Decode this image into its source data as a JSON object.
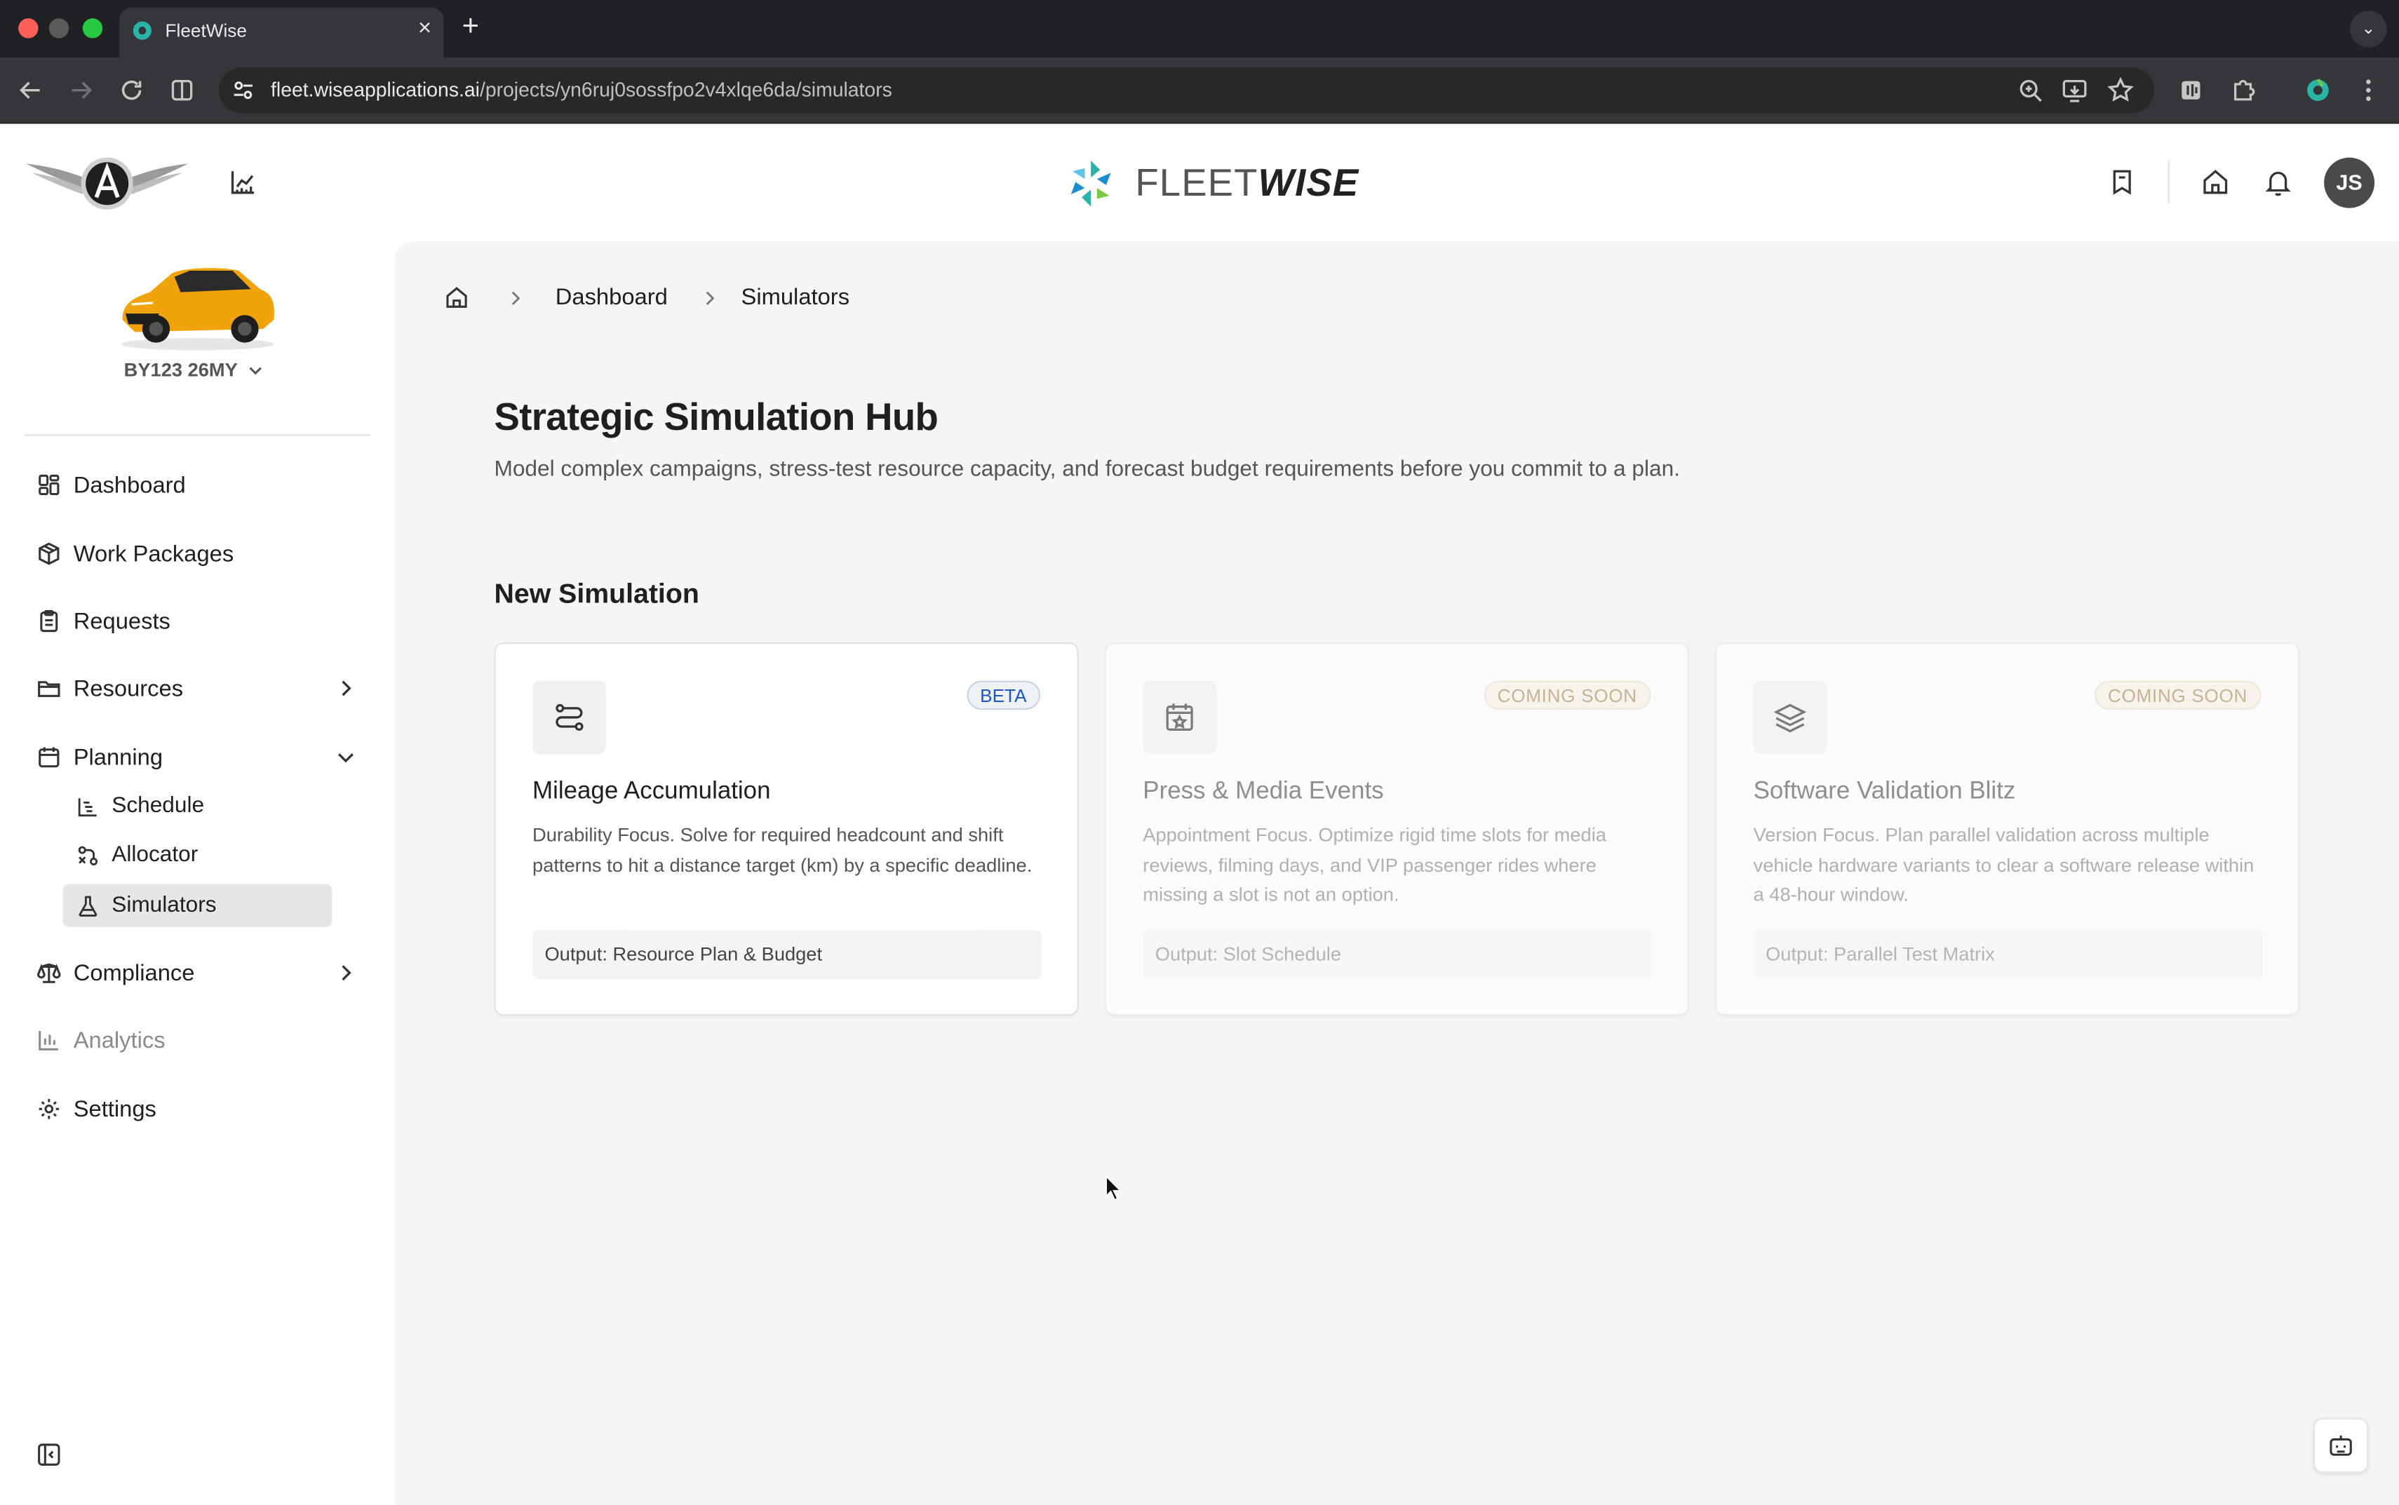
{
  "browser": {
    "tab_title": "FleetWise",
    "url_host": "fleet.wiseapplications.ai",
    "url_path": "/projects/yn6ruj0sossfpo2v4xlqe6da/simulators"
  },
  "header": {
    "brand_light": "FLEET",
    "brand_bold": "WISE",
    "avatar_initials": "JS"
  },
  "sidebar": {
    "vehicle": "BY123 26MY",
    "items": [
      {
        "label": "Dashboard",
        "icon": "dashboard-icon"
      },
      {
        "label": "Work Packages",
        "icon": "package-icon"
      },
      {
        "label": "Requests",
        "icon": "clipboard-icon"
      },
      {
        "label": "Resources",
        "icon": "folder-icon"
      },
      {
        "label": "Planning",
        "icon": "calendar-icon"
      },
      {
        "label": "Compliance",
        "icon": "scale-icon"
      },
      {
        "label": "Analytics",
        "icon": "bar-chart-icon"
      },
      {
        "label": "Settings",
        "icon": "gear-icon"
      }
    ],
    "planning_sub": [
      {
        "label": "Schedule",
        "icon": "gantt-icon"
      },
      {
        "label": "Allocator",
        "icon": "allocator-icon"
      },
      {
        "label": "Simulators",
        "icon": "flask-icon"
      }
    ]
  },
  "breadcrumb": {
    "items": [
      "Dashboard",
      "Simulators"
    ]
  },
  "main": {
    "title": "Strategic Simulation Hub",
    "subtitle": "Model complex campaigns, stress-test resource capacity, and forecast budget requirements before you commit to a plan.",
    "section_title": "New Simulation",
    "cards": [
      {
        "title": "Mileage Accumulation",
        "badge": "BETA",
        "description": "Durability Focus. Solve for required headcount and shift patterns to hit a distance target (km) by a specific deadline.",
        "output": "Output: Resource Plan & Budget",
        "icon": "route-icon"
      },
      {
        "title": "Press & Media Events",
        "badge": "COMING SOON",
        "description": "Appointment Focus. Optimize rigid time slots for media reviews, filming days, and VIP passenger rides where missing a slot is not an option.",
        "output": "Output: Slot Schedule",
        "icon": "calendar-star-icon"
      },
      {
        "title": "Software Validation Blitz",
        "badge": "COMING SOON",
        "description": "Version Focus. Plan parallel validation across multiple vehicle hardware variants to clear a software release within a 48-hour window.",
        "output": "Output: Parallel Test Matrix",
        "icon": "layers-icon"
      }
    ]
  },
  "colors": {
    "beta_text": "#1a56c8",
    "coming_soon_text": "#c5b394",
    "active_nav_bg": "#e6e6e6",
    "main_bg": "#f5f5f5"
  }
}
